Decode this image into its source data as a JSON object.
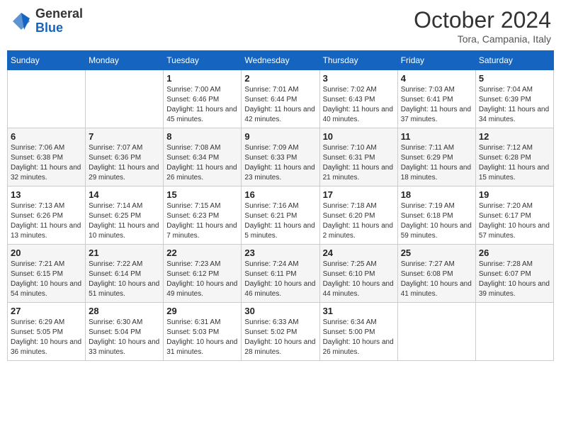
{
  "header": {
    "logo_general": "General",
    "logo_blue": "Blue",
    "month_title": "October 2024",
    "location": "Tora, Campania, Italy"
  },
  "days_of_week": [
    "Sunday",
    "Monday",
    "Tuesday",
    "Wednesday",
    "Thursday",
    "Friday",
    "Saturday"
  ],
  "weeks": [
    [
      {
        "day": "",
        "info": ""
      },
      {
        "day": "",
        "info": ""
      },
      {
        "day": "1",
        "info": "Sunrise: 7:00 AM\nSunset: 6:46 PM\nDaylight: 11 hours and 45 minutes."
      },
      {
        "day": "2",
        "info": "Sunrise: 7:01 AM\nSunset: 6:44 PM\nDaylight: 11 hours and 42 minutes."
      },
      {
        "day": "3",
        "info": "Sunrise: 7:02 AM\nSunset: 6:43 PM\nDaylight: 11 hours and 40 minutes."
      },
      {
        "day": "4",
        "info": "Sunrise: 7:03 AM\nSunset: 6:41 PM\nDaylight: 11 hours and 37 minutes."
      },
      {
        "day": "5",
        "info": "Sunrise: 7:04 AM\nSunset: 6:39 PM\nDaylight: 11 hours and 34 minutes."
      }
    ],
    [
      {
        "day": "6",
        "info": "Sunrise: 7:06 AM\nSunset: 6:38 PM\nDaylight: 11 hours and 32 minutes."
      },
      {
        "day": "7",
        "info": "Sunrise: 7:07 AM\nSunset: 6:36 PM\nDaylight: 11 hours and 29 minutes."
      },
      {
        "day": "8",
        "info": "Sunrise: 7:08 AM\nSunset: 6:34 PM\nDaylight: 11 hours and 26 minutes."
      },
      {
        "day": "9",
        "info": "Sunrise: 7:09 AM\nSunset: 6:33 PM\nDaylight: 11 hours and 23 minutes."
      },
      {
        "day": "10",
        "info": "Sunrise: 7:10 AM\nSunset: 6:31 PM\nDaylight: 11 hours and 21 minutes."
      },
      {
        "day": "11",
        "info": "Sunrise: 7:11 AM\nSunset: 6:29 PM\nDaylight: 11 hours and 18 minutes."
      },
      {
        "day": "12",
        "info": "Sunrise: 7:12 AM\nSunset: 6:28 PM\nDaylight: 11 hours and 15 minutes."
      }
    ],
    [
      {
        "day": "13",
        "info": "Sunrise: 7:13 AM\nSunset: 6:26 PM\nDaylight: 11 hours and 13 minutes."
      },
      {
        "day": "14",
        "info": "Sunrise: 7:14 AM\nSunset: 6:25 PM\nDaylight: 11 hours and 10 minutes."
      },
      {
        "day": "15",
        "info": "Sunrise: 7:15 AM\nSunset: 6:23 PM\nDaylight: 11 hours and 7 minutes."
      },
      {
        "day": "16",
        "info": "Sunrise: 7:16 AM\nSunset: 6:21 PM\nDaylight: 11 hours and 5 minutes."
      },
      {
        "day": "17",
        "info": "Sunrise: 7:18 AM\nSunset: 6:20 PM\nDaylight: 11 hours and 2 minutes."
      },
      {
        "day": "18",
        "info": "Sunrise: 7:19 AM\nSunset: 6:18 PM\nDaylight: 10 hours and 59 minutes."
      },
      {
        "day": "19",
        "info": "Sunrise: 7:20 AM\nSunset: 6:17 PM\nDaylight: 10 hours and 57 minutes."
      }
    ],
    [
      {
        "day": "20",
        "info": "Sunrise: 7:21 AM\nSunset: 6:15 PM\nDaylight: 10 hours and 54 minutes."
      },
      {
        "day": "21",
        "info": "Sunrise: 7:22 AM\nSunset: 6:14 PM\nDaylight: 10 hours and 51 minutes."
      },
      {
        "day": "22",
        "info": "Sunrise: 7:23 AM\nSunset: 6:12 PM\nDaylight: 10 hours and 49 minutes."
      },
      {
        "day": "23",
        "info": "Sunrise: 7:24 AM\nSunset: 6:11 PM\nDaylight: 10 hours and 46 minutes."
      },
      {
        "day": "24",
        "info": "Sunrise: 7:25 AM\nSunset: 6:10 PM\nDaylight: 10 hours and 44 minutes."
      },
      {
        "day": "25",
        "info": "Sunrise: 7:27 AM\nSunset: 6:08 PM\nDaylight: 10 hours and 41 minutes."
      },
      {
        "day": "26",
        "info": "Sunrise: 7:28 AM\nSunset: 6:07 PM\nDaylight: 10 hours and 39 minutes."
      }
    ],
    [
      {
        "day": "27",
        "info": "Sunrise: 6:29 AM\nSunset: 5:05 PM\nDaylight: 10 hours and 36 minutes."
      },
      {
        "day": "28",
        "info": "Sunrise: 6:30 AM\nSunset: 5:04 PM\nDaylight: 10 hours and 33 minutes."
      },
      {
        "day": "29",
        "info": "Sunrise: 6:31 AM\nSunset: 5:03 PM\nDaylight: 10 hours and 31 minutes."
      },
      {
        "day": "30",
        "info": "Sunrise: 6:33 AM\nSunset: 5:02 PM\nDaylight: 10 hours and 28 minutes."
      },
      {
        "day": "31",
        "info": "Sunrise: 6:34 AM\nSunset: 5:00 PM\nDaylight: 10 hours and 26 minutes."
      },
      {
        "day": "",
        "info": ""
      },
      {
        "day": "",
        "info": ""
      }
    ]
  ]
}
